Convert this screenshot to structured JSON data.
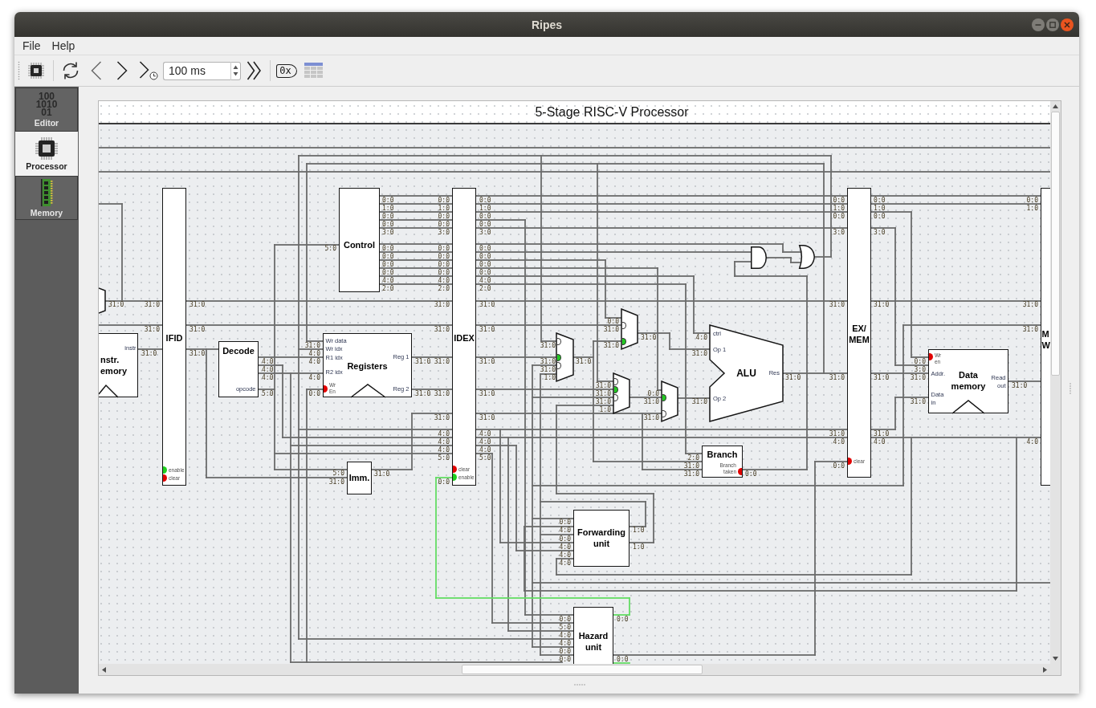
{
  "window": {
    "title": "Ripes"
  },
  "menu": [
    "File",
    "Help"
  ],
  "toolbar": {
    "delay": "100 ms",
    "hex_toggle": "0x"
  },
  "sidebar": {
    "tabs": [
      {
        "label": "Editor",
        "selected": false,
        "icon_lines": [
          "100",
          "1010",
          "01"
        ]
      },
      {
        "label": "Processor",
        "selected": true
      },
      {
        "label": "Memory",
        "selected": false
      }
    ]
  },
  "diagram": {
    "title": "5-Stage RISC-V Processor",
    "components": [
      {
        "kind": "adder",
        "outputs": [
          "31:0"
        ]
      },
      {
        "kind": "memory",
        "label_lines": [
          "nstr.",
          "emory"
        ],
        "ports_inside": [
          [
            "instr"
          ]
        ],
        "outputs": [
          "31:0"
        ]
      },
      {
        "kind": "pipeline",
        "label_lines": [
          "IFID"
        ],
        "inputs": [
          "31:0",
          "31:0"
        ],
        "outputs": [
          "31:0",
          "31:0",
          "31:0"
        ],
        "signals": [
          {
            "label_lines": [
              "enable"
            ],
            "high": true
          },
          {
            "label_lines": [
              "clear"
            ],
            "high": false
          }
        ]
      },
      {
        "kind": "block",
        "label_lines": [
          "Control"
        ],
        "inputs": [
          "5:0"
        ],
        "outputs": [
          "0:0",
          "1:0",
          "0:0",
          "0:0",
          "3:0",
          "0:0",
          "0:0",
          "0:0",
          "0:0",
          "4:0",
          "2:0"
        ]
      },
      {
        "kind": "block",
        "label_lines": [
          "Decode"
        ],
        "ports_inside": [
          [
            "opcode"
          ]
        ],
        "outputs": [
          "4:0",
          "4:0",
          "4:0",
          "5:0"
        ]
      },
      {
        "kind": "memory",
        "label_lines": [
          "Registers"
        ],
        "ports_inside": [
          [
            "Wr data"
          ],
          [
            "Wr idx"
          ],
          [
            "R1 idx"
          ],
          [
            "R2 idx"
          ],
          [
            "Reg 1"
          ],
          [
            "Reg 2"
          ]
        ],
        "inputs": [
          "31:0",
          "4:0",
          "4:0",
          "4:0",
          "0:0"
        ],
        "outputs": [
          "31:0",
          "31:0"
        ],
        "signals": [
          {
            "label_lines": [
              "Wr",
              "En"
            ],
            "high": false
          }
        ]
      },
      {
        "kind": "block",
        "label_lines": [
          "Imm."
        ],
        "inputs": [
          "5:0",
          "31:0"
        ],
        "outputs": [
          "31:0"
        ]
      },
      {
        "kind": "pipeline",
        "label_lines": [
          "IDEX"
        ],
        "inputs": [
          "0:0",
          "1:0",
          "0:0",
          "0:0",
          "3:0",
          "0:0",
          "0:0",
          "0:0",
          "0:0",
          "4:0",
          "2:0",
          "31:0",
          "31:0",
          "31:0",
          "31:0",
          "31:0",
          "4:0",
          "4:0",
          "4:0",
          "5:0",
          "0:0"
        ],
        "outputs": [
          "0:0",
          "1:0",
          "0:0",
          "0:0",
          "3:0",
          "0:0",
          "0:0",
          "0:0",
          "0:0",
          "4:0",
          "2:0",
          "31:0",
          "31:0",
          "31:0",
          "31:0",
          "31:0",
          "4:0",
          "4:0",
          "4:0",
          "5:0"
        ],
        "signals": [
          {
            "label_lines": [
              "clear"
            ],
            "high": false
          },
          {
            "label_lines": [
              "enable"
            ],
            "high": true
          }
        ]
      },
      {
        "kind": "mux",
        "select": "0:0",
        "inputs": [
          {
            "label": "31:0",
            "selected": false
          },
          {
            "label": "31:0",
            "selected": true
          }
        ],
        "outputs": [
          "31:0"
        ]
      },
      {
        "kind": "mux",
        "select": "1:0",
        "inputs": [
          {
            "label": "31:0",
            "selected": false
          },
          {
            "label": "31:0",
            "selected": true
          },
          {
            "label": "31:0",
            "selected": false
          }
        ],
        "outputs": [
          "31:0"
        ]
      },
      {
        "kind": "mux",
        "select": "1:0",
        "inputs": [
          {
            "label": "31:0",
            "selected": false
          },
          {
            "label": "31:0",
            "selected": true
          },
          {
            "label": "31:0",
            "selected": false
          }
        ]
      },
      {
        "kind": "mux",
        "select": "0:0",
        "inputs": [
          {
            "label": "31:0",
            "selected": true
          },
          {
            "label": "31:0",
            "selected": false
          }
        ]
      },
      {
        "kind": "alu",
        "label_lines": [
          "ALU"
        ],
        "ports_inside": [
          [
            "ctrl"
          ],
          [
            "Op 1"
          ],
          [
            "Op 2"
          ],
          [
            "Res"
          ]
        ],
        "inputs": [
          "4:0",
          "31:0",
          "31:0"
        ],
        "outputs": [
          "31:0"
        ]
      },
      {
        "kind": "block",
        "label_lines": [
          "Branch"
        ],
        "inputs": [
          "2:0",
          "31:0",
          "31:0"
        ],
        "outputs": [
          "0:0"
        ],
        "signals": [
          {
            "label_lines": [
              "Branch",
              "taken"
            ],
            "high": false
          }
        ]
      },
      {
        "kind": "and_gate"
      },
      {
        "kind": "or_gate"
      },
      {
        "kind": "pipeline",
        "label_lines": [
          "EX/",
          "MEM"
        ],
        "inputs": [
          "0:0",
          "1:0",
          "0:0",
          "3:0",
          "31:0",
          "31:0",
          "31:0",
          "4:0",
          "0:0"
        ],
        "outputs": [
          "0:0",
          "1:0",
          "0:0",
          "3:0",
          "31:0",
          "31:0",
          "31:0",
          "4:0"
        ],
        "signals": [
          {
            "label_lines": [
              "clear"
            ],
            "high": false
          }
        ]
      },
      {
        "kind": "memory",
        "label_lines": [
          "Data",
          "memory"
        ],
        "ports_inside": [
          [
            "Addr."
          ],
          [
            "Data",
            "in"
          ],
          [
            "Read",
            "out"
          ]
        ],
        "inputs": [
          "0:0",
          "3:0",
          "31:0",
          "31:0"
        ],
        "outputs": [
          "31:0"
        ],
        "signals": [
          {
            "label_lines": [
              "Wr",
              "en"
            ],
            "high": false
          }
        ]
      },
      {
        "kind": "pipeline",
        "label_lines": [
          "M",
          "W"
        ],
        "inputs": [
          "0:0",
          "1:0",
          "31:0",
          "31:0",
          "4:0"
        ]
      },
      {
        "kind": "block",
        "label_lines": [
          "Forwarding",
          "unit"
        ],
        "inputs": [
          "0:0",
          "4:0",
          "0:0",
          "4:0",
          "4:0",
          "4:0"
        ],
        "outputs": [
          "1:0",
          "1:0"
        ]
      },
      {
        "kind": "block",
        "label_lines": [
          "Hazard",
          "unit"
        ],
        "inputs": [
          "0:0",
          "5:0",
          "4:0",
          "4:0",
          "0:0",
          "0:0"
        ],
        "outputs": [
          {
            "label": "0:0",
            "high": true
          },
          {
            "label": "0:0",
            "high": true
          }
        ]
      }
    ]
  }
}
